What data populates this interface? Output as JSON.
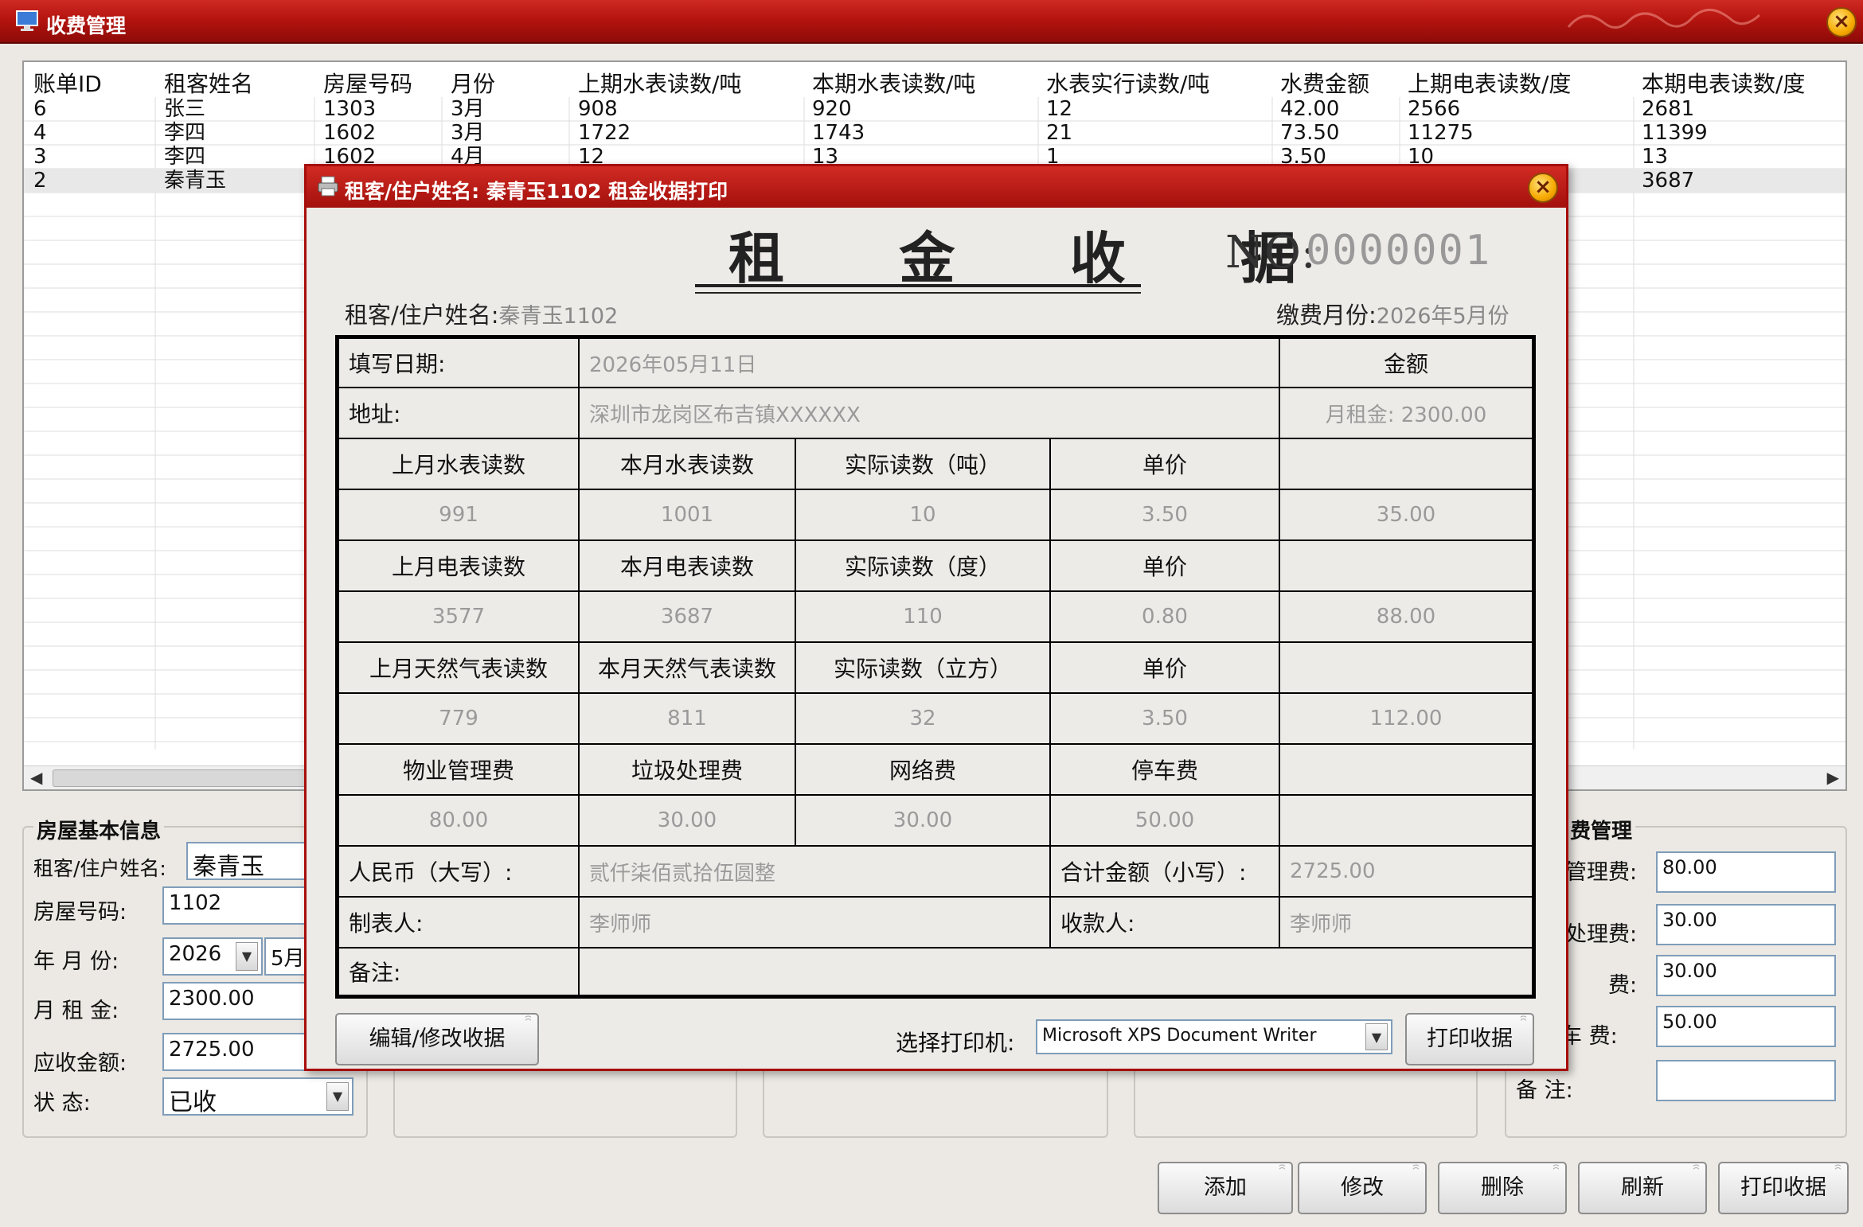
{
  "window": {
    "title": "收费管理"
  },
  "grid": {
    "columns": [
      "账单ID",
      "租客姓名",
      "房屋号码",
      "月份",
      "上期水表读数/吨",
      "本期水表读数/吨",
      "水表实行读数/吨",
      "水费金额",
      "上期电表读数/度",
      "本期电表读数/度"
    ],
    "rows": [
      [
        "6",
        "张三",
        "1303",
        "3月",
        "908",
        "920",
        "12",
        "42.00",
        "2566",
        "2681"
      ],
      [
        "4",
        "李四",
        "1602",
        "3月",
        "1722",
        "1743",
        "21",
        "73.50",
        "11275",
        "11399"
      ],
      [
        "3",
        "李四",
        "1602",
        "4月",
        "12",
        "13",
        "1",
        "3.50",
        "10",
        "13"
      ],
      [
        "2",
        "秦青玉",
        "",
        "",
        "",
        "",
        "",
        "",
        "",
        "3687"
      ]
    ]
  },
  "house_info": {
    "title": "房屋基本信息",
    "tenant_label": "租客/住户姓名:",
    "tenant_value": "秦青玉",
    "room_label": "房屋号码:",
    "room_value": "1102",
    "month_label": "年 月 份:",
    "year_value": "2026",
    "month_value": "5月",
    "rent_label": "月 租 金:",
    "rent_value": "2300.00",
    "due_label": "应收金额:",
    "due_value": "2725.00",
    "status_label": "状    态:",
    "status_value": "已收"
  },
  "fee_mgmt": {
    "title": "费管理",
    "mgmt_label": "管理费:",
    "mgmt_value": "80.00",
    "garbage_label": "处理费:",
    "garbage_value": "30.00",
    "net_label": "费:",
    "net_value": "30.00",
    "park_label": "车    费:",
    "park_value": "50.00",
    "note_label": "备      注:",
    "note_value": ""
  },
  "main_buttons": {
    "add": "添加",
    "edit": "修改",
    "delete": "删除",
    "refresh": "刷新",
    "print": "打印收据"
  },
  "dialog": {
    "title": "租客/住户姓名: 秦青玉1102 租金收据打印",
    "receipt_title": "租 金 收 据",
    "no_label": "NO:",
    "no_value": "0000001",
    "tenant_label": "租客/住户姓名:",
    "tenant_value": "秦青玉1102",
    "month_label": "缴费月份:",
    "month_value": "2026年5月份",
    "date_label": "填写日期:",
    "date_value": "2026年05月11日",
    "amount_label": "金额",
    "address_label": "地址:",
    "address_value": "深圳市龙岗区布吉镇XXXXXX",
    "rent_text": "月租金: 2300.00",
    "water": {
      "prev_label": "上月水表读数",
      "cur_label": "本月水表读数",
      "actual_label": "实际读数（吨）",
      "price_label": "单价",
      "prev": "991",
      "cur": "1001",
      "actual": "10",
      "price": "3.50",
      "amount": "35.00"
    },
    "elec": {
      "prev_label": "上月电表读数",
      "cur_label": "本月电表读数",
      "actual_label": "实际读数（度）",
      "price_label": "单价",
      "prev": "3577",
      "cur": "3687",
      "actual": "110",
      "price": "0.80",
      "amount": "88.00"
    },
    "gas": {
      "prev_label": "上月天然气表读数",
      "cur_label": "本月天然气表读数",
      "actual_label": "实际读数（立方）",
      "price_label": "单价",
      "prev": "779",
      "cur": "811",
      "actual": "32",
      "price": "3.50",
      "amount": "112.00"
    },
    "fees": {
      "mgmt_label": "物业管理费",
      "garbage_label": "垃圾处理费",
      "net_label": "网络费",
      "park_label": "停车费",
      "mgmt": "80.00",
      "garbage": "30.00",
      "net": "30.00",
      "park": "50.00"
    },
    "rmb_label": "人民币（大写）:",
    "rmb_value": "贰仟柒佰贰拾伍圆整",
    "total_label": "合计金额（小写）:",
    "total_value": "2725.00",
    "maker_label": "制表人:",
    "maker_value": "李师师",
    "payee_label": "收款人:",
    "payee_value": "李师师",
    "remark_label": "备注:",
    "edit_button": "编辑/修改收据",
    "printer_label": "选择打印机:",
    "printer_value": "Microsoft XPS Document Writer",
    "print_button": "打印收据"
  }
}
